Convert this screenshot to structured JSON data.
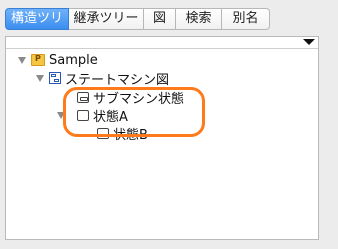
{
  "tabs": [
    {
      "label": "構造ツリー",
      "active": true
    },
    {
      "label": "継承ツリー",
      "active": false
    },
    {
      "label": "図",
      "active": false
    },
    {
      "label": "検索",
      "active": false
    },
    {
      "label": "別名",
      "active": false
    }
  ],
  "tree": {
    "root": {
      "label": "Sample",
      "icon": "project-folder-icon"
    },
    "diagram": {
      "label": "ステートマシン図",
      "icon": "state-machine-diagram-icon"
    },
    "submachine": {
      "label": "サブマシン状態",
      "icon": "submachine-state-icon"
    },
    "stateA": {
      "label": "状態A",
      "icon": "state-icon"
    },
    "stateB": {
      "label": "状態B",
      "icon": "state-icon"
    }
  },
  "highlight": {
    "color": "#ff7a1a"
  }
}
